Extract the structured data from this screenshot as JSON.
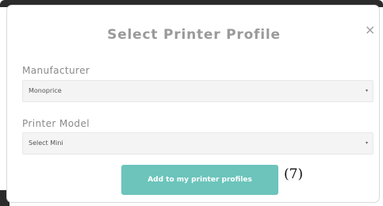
{
  "dialog": {
    "title": "Select Printer Profile",
    "close_icon": "×"
  },
  "manufacturer": {
    "label": "Manufacturer",
    "selected": "Monoprice"
  },
  "printer_model": {
    "label": "Printer Model",
    "selected": "Select Mini"
  },
  "caret_icon": "▾",
  "actions": {
    "add_label": "Add to my printer profiles"
  },
  "annotation": "(7)",
  "colors": {
    "accent": "#6cc4bb",
    "title": "#9a9a9a",
    "field_background": "#f4f4f4"
  }
}
